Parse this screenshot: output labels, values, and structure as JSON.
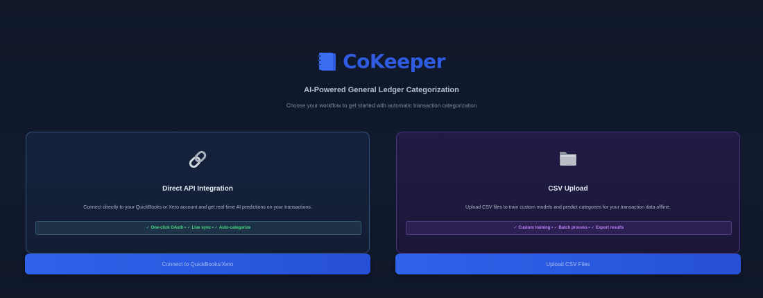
{
  "brand": {
    "name": "CoKeeper",
    "logo_icon": "notebook-icon",
    "color": "#2f5be0"
  },
  "header": {
    "tagline": "AI-Powered General Ledger Categorization",
    "subtitle": "Choose your workflow to get started with automatic transaction categorization"
  },
  "cards": {
    "api": {
      "icon": "link-icon",
      "title": "Direct API Integration",
      "description": "Connect directly to your QuickBooks or Xero account and get real-time AI predictions on your transactions.",
      "features": "✓ One-click OAuth • ✓ Live sync • ✓ Auto-categorize",
      "feature_color": "#4ade80",
      "button_label": "Connect to QuickBooks/Xero"
    },
    "csv": {
      "icon": "folder-icon",
      "title": "CSV Upload",
      "description": "Upload CSV files to train custom models and predict categories for your transaction data offline.",
      "features": "✓ Custom training • ✓ Batch process • ✓ Export results",
      "feature_color": "#c084fc",
      "button_label": "Upload CSV Files"
    }
  },
  "colors": {
    "background": "#0f172a",
    "button": "#2e63ea"
  }
}
